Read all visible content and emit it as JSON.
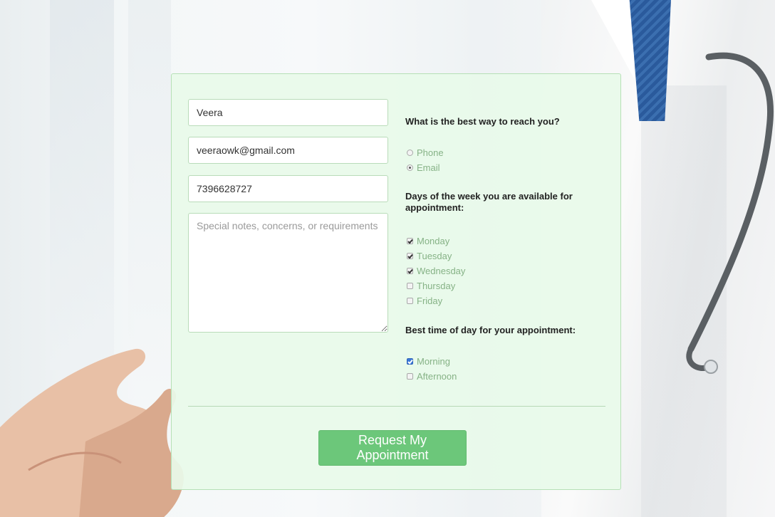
{
  "form": {
    "name_value": "Veera",
    "email_value": "veeraowk@gmail.com",
    "phone_value": "7396628727",
    "notes_placeholder": "Special notes, concerns, or requirements",
    "contact": {
      "question": "What is the best way to reach you?",
      "options": [
        {
          "label": "Phone",
          "selected": false
        },
        {
          "label": "Email",
          "selected": true
        }
      ]
    },
    "days": {
      "question": "Days of the week you are available for appointment:",
      "options": [
        {
          "label": "Monday",
          "checked": true
        },
        {
          "label": "Tuesday",
          "checked": true
        },
        {
          "label": "Wednesday",
          "checked": true
        },
        {
          "label": "Thursday",
          "checked": false
        },
        {
          "label": "Friday",
          "checked": false
        }
      ]
    },
    "time": {
      "question": "Best time of day for your appointment:",
      "options": [
        {
          "label": "Morning",
          "checked": true
        },
        {
          "label": "Afternoon",
          "checked": false
        }
      ]
    },
    "submit_label": "Request My Appointment"
  },
  "colors": {
    "card_background": "#e8fae9",
    "card_border": "#b6e0b6",
    "option_text": "#86b286",
    "submit_button": "#6cc77a",
    "checked_accent": "#3b78d9"
  }
}
